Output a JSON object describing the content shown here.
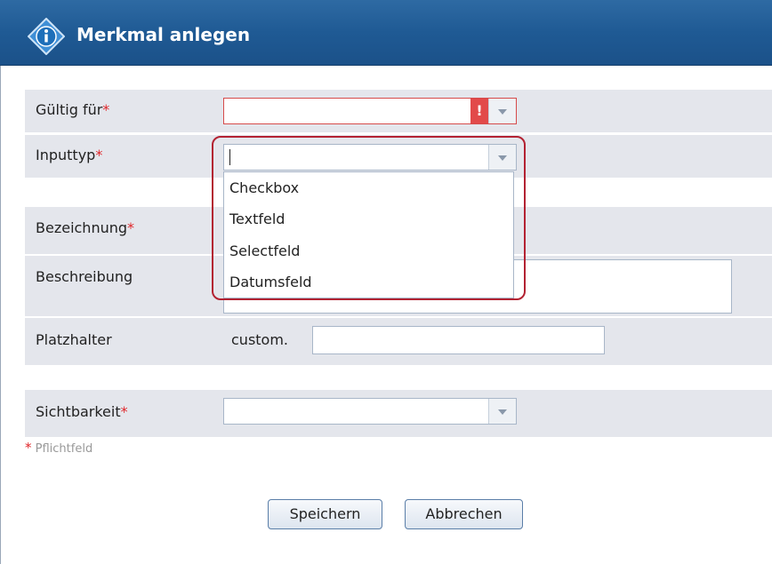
{
  "dialog": {
    "title": "Merkmal anlegen",
    "icon": "info-icon"
  },
  "fields": {
    "gueltig": {
      "label": "Gültig für",
      "required_mark": "*",
      "value": ""
    },
    "inputtyp": {
      "label": "Inputtyp",
      "required_mark": "*",
      "value": ""
    },
    "bezeichnung": {
      "label": "Bezeichnung",
      "required_mark": "*"
    },
    "beschreibung": {
      "label": "Beschreibung"
    },
    "platzhalter": {
      "label": "Platzhalter",
      "prefix": "custom.",
      "value": ""
    },
    "sichtbarkeit": {
      "label": "Sichtbarkeit",
      "required_mark": "*",
      "value": ""
    }
  },
  "dropdown_options": [
    "Checkbox",
    "Textfeld",
    "Selectfeld",
    "Datumsfeld"
  ],
  "footnote": {
    "mark": "*",
    "text": "Pflichtfeld"
  },
  "buttons": {
    "save": "Speichern",
    "cancel": "Abbrechen"
  },
  "colors": {
    "titlebar": "#1f5a94",
    "band": "#e4e6ec",
    "required": "#e0262a",
    "highlight": "#b32232",
    "error": "#e24a4a"
  }
}
